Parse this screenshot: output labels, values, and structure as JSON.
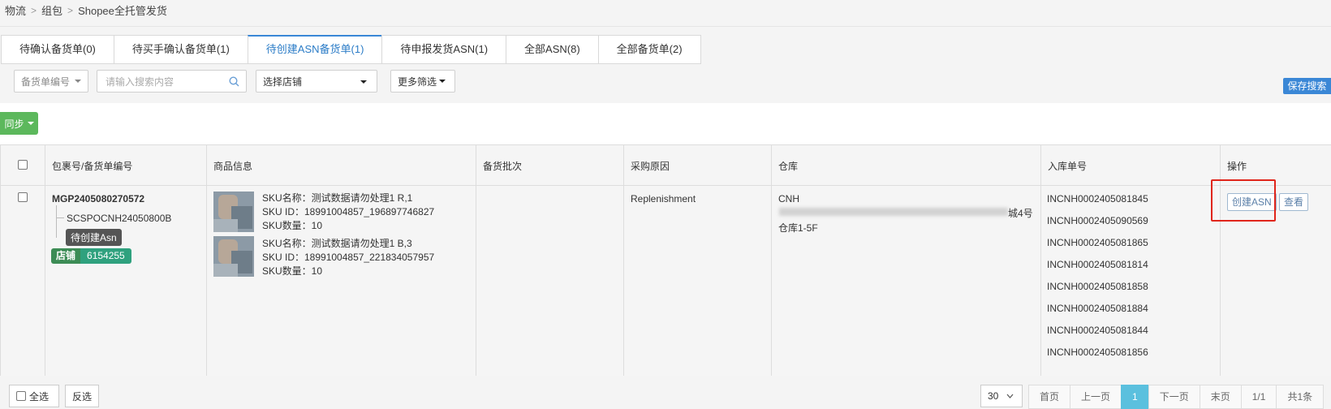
{
  "breadcrumb": [
    "物流",
    "组包",
    "Shopee全托管发货"
  ],
  "tabs": [
    {
      "label": "待确认备货单(0)"
    },
    {
      "label": "待买手确认备货单(1)"
    },
    {
      "label": "待创建ASN备货单(1)",
      "active": true
    },
    {
      "label": "待申报发货ASN(1)"
    },
    {
      "label": "全部ASN(8)"
    },
    {
      "label": "全部备货单(2)"
    }
  ],
  "filters": {
    "type_select": "备货单编号",
    "search_placeholder": "请输入搜索内容",
    "shop_select": "选择店铺",
    "more_filter": "更多筛选",
    "save_search": "保存搜索"
  },
  "toolbar": {
    "sync_label": "同步"
  },
  "table": {
    "headers": [
      "包裹号/备货单编号",
      "商品信息",
      "备货批次",
      "采购原因",
      "仓库",
      "入库单号",
      "操作"
    ],
    "row": {
      "package_no": "MGP2405080270572",
      "order_no": "SCSPOCNH24050800B",
      "status_badge": "待创建Asn",
      "store_label": "店铺",
      "store_id": "6154255",
      "products": [
        {
          "name": "SKU名称：测试数据请勿处理1 R,1",
          "sku_id": "SKU ID：18991004857_196897746827",
          "qty": "SKU数量：10"
        },
        {
          "name": "SKU名称：测试数据请勿处理1 B,3",
          "sku_id": "SKU ID：18991004857_221834057957",
          "qty": "SKU数量：10"
        }
      ],
      "batch": "",
      "reason": "Replenishment",
      "warehouse_code": "CNH",
      "warehouse_addr_tail": "城4号",
      "warehouse_floor": "仓库1-5F",
      "inbound_nos": [
        "INCNH0002405081845",
        "INCNH0002405090569",
        "INCNH0002405081865",
        "INCNH0002405081814",
        "INCNH0002405081858",
        "INCNH0002405081884",
        "INCNH0002405081844",
        "INCNH0002405081856"
      ],
      "actions": {
        "create_asn": "创建ASN",
        "view": "查看"
      }
    }
  },
  "footer": {
    "select_all": "全选",
    "invert": "反选",
    "page_size": "30",
    "first": "首页",
    "prev": "上一页",
    "current": "1",
    "next": "下一页",
    "last": "末页",
    "pages": "1/1",
    "total": "共1条"
  },
  "colors": {
    "accent": "#3a87d6",
    "sync_green": "#5cb85c",
    "highlight": "#e0251b",
    "store_green": "#2fa17e"
  }
}
